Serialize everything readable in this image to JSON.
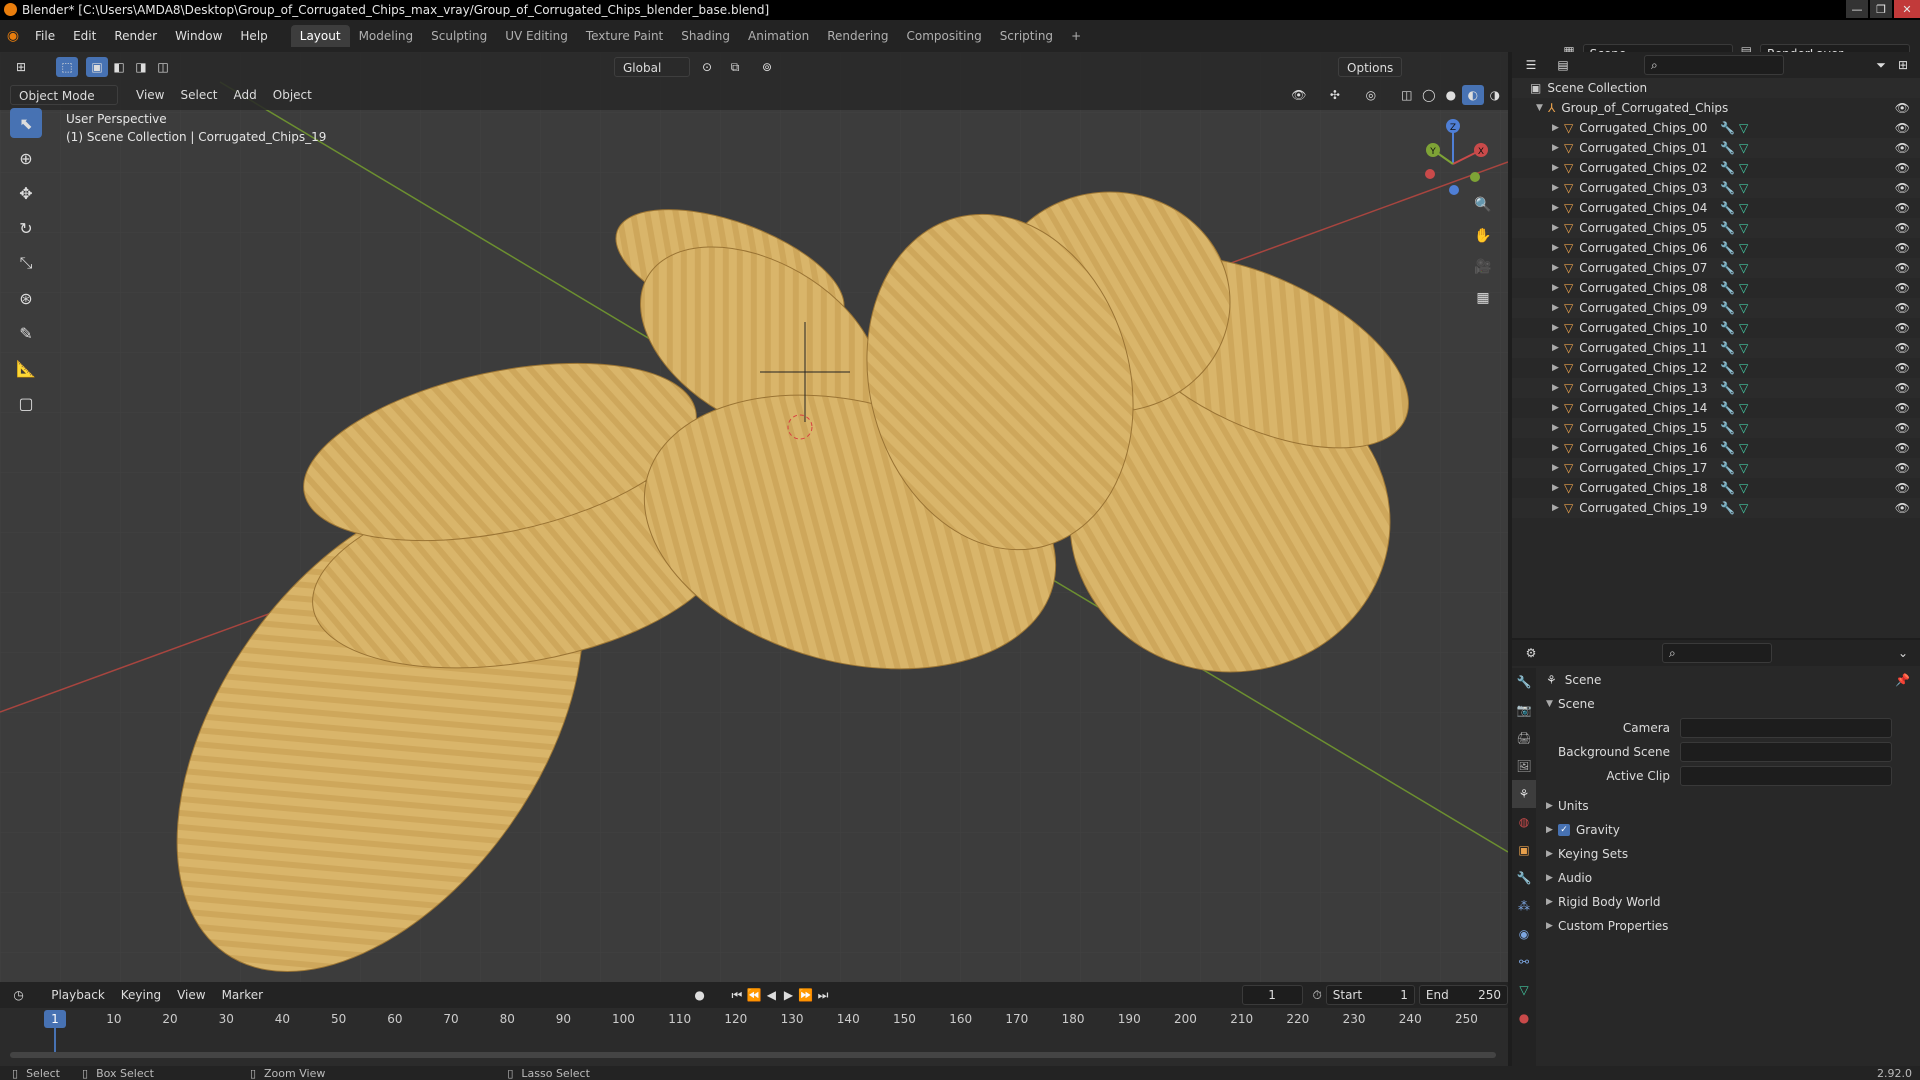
{
  "window": {
    "title": "Blender* [C:\\Users\\AMDA8\\Desktop\\Group_of_Corrugated_Chips_max_vray/Group_of_Corrugated_Chips_blender_base.blend]"
  },
  "menu": [
    "File",
    "Edit",
    "Render",
    "Window",
    "Help"
  ],
  "workspaces": [
    {
      "label": "Layout",
      "active": true
    },
    {
      "label": "Modeling"
    },
    {
      "label": "Sculpting"
    },
    {
      "label": "UV Editing"
    },
    {
      "label": "Texture Paint"
    },
    {
      "label": "Shading"
    },
    {
      "label": "Animation"
    },
    {
      "label": "Rendering"
    },
    {
      "label": "Compositing"
    },
    {
      "label": "Scripting"
    }
  ],
  "scene_selector": {
    "scene": "Scene",
    "view_layer": "RenderLayer"
  },
  "viewport": {
    "transform_orientation": "Global",
    "options_label": "Options",
    "mode": "Object Mode",
    "menus": [
      "View",
      "Select",
      "Add",
      "Object"
    ],
    "overlay_line1": "User Perspective",
    "overlay_line2": "(1) Scene Collection | Corrugated_Chips_19",
    "gizmo_axes": {
      "x": "X",
      "y": "Y",
      "z": "Z"
    },
    "colors": {
      "bg": "#3c3c3c",
      "x_axis": "#c94a4a",
      "y_axis": "#7ea336",
      "chip": "#d8b468",
      "chip_dark": "#b68c3f"
    }
  },
  "outliner": {
    "root": "Scene Collection",
    "collection": "Group_of_Corrugated_Chips",
    "objects": [
      "Corrugated_Chips_00",
      "Corrugated_Chips_01",
      "Corrugated_Chips_02",
      "Corrugated_Chips_03",
      "Corrugated_Chips_04",
      "Corrugated_Chips_05",
      "Corrugated_Chips_06",
      "Corrugated_Chips_07",
      "Corrugated_Chips_08",
      "Corrugated_Chips_09",
      "Corrugated_Chips_10",
      "Corrugated_Chips_11",
      "Corrugated_Chips_12",
      "Corrugated_Chips_13",
      "Corrugated_Chips_14",
      "Corrugated_Chips_15",
      "Corrugated_Chips_16",
      "Corrugated_Chips_17",
      "Corrugated_Chips_18",
      "Corrugated_Chips_19"
    ]
  },
  "properties": {
    "context": "Scene",
    "panel": "Scene",
    "fields": [
      {
        "label": "Camera"
      },
      {
        "label": "Background Scene"
      },
      {
        "label": "Active Clip"
      }
    ],
    "sections": [
      {
        "label": "Units"
      },
      {
        "label": "Gravity",
        "checked": true
      },
      {
        "label": "Keying Sets"
      },
      {
        "label": "Audio"
      },
      {
        "label": "Rigid Body World"
      },
      {
        "label": "Custom Properties"
      }
    ]
  },
  "timeline": {
    "menus": [
      "Playback",
      "Keying",
      "View",
      "Marker"
    ],
    "current_frame": "1",
    "start_label": "Start",
    "start": "1",
    "end_label": "End",
    "end": "250",
    "ticks": [
      "10",
      "20",
      "30",
      "40",
      "50",
      "60",
      "70",
      "80",
      "90",
      "100",
      "110",
      "120",
      "130",
      "140",
      "150",
      "160",
      "170",
      "180",
      "190",
      "200",
      "210",
      "220",
      "230",
      "240",
      "250"
    ]
  },
  "statusbar": {
    "select": "Select",
    "box_select": "Box Select",
    "zoom_view": "Zoom View",
    "lasso_select": "Lasso Select",
    "version": "2.92.0"
  }
}
